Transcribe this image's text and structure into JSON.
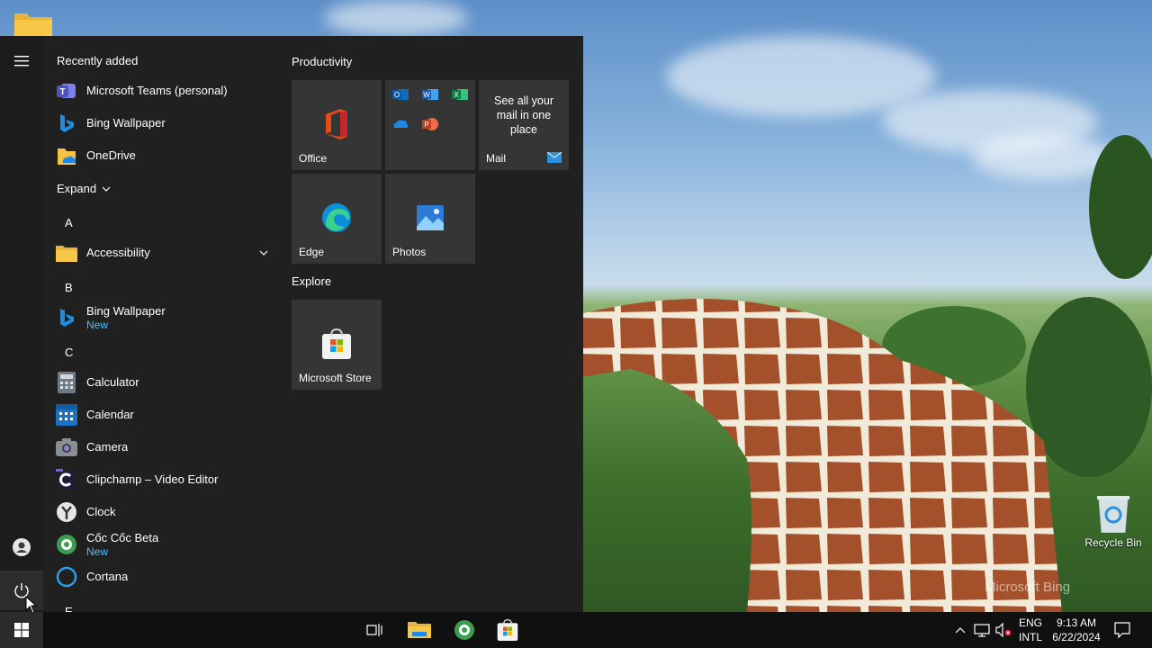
{
  "desktop": {
    "recycle_bin_label": "Recycle Bin",
    "watermark": "Microsoft Bing"
  },
  "start_menu": {
    "recently_added_label": "Recently added",
    "recent_apps": [
      {
        "name": "Microsoft Teams (personal)",
        "icon": "teams-icon"
      },
      {
        "name": "Bing Wallpaper",
        "icon": "bing-icon"
      },
      {
        "name": "OneDrive",
        "icon": "onedrive-icon"
      }
    ],
    "expand_label": "Expand",
    "letters": [
      "A",
      "B",
      "C",
      "E"
    ],
    "apps": [
      {
        "name": "Accessibility",
        "icon": "folder-icon"
      },
      {
        "name": "Bing Wallpaper",
        "sub": "New",
        "icon": "bing-icon"
      },
      {
        "name": "Calculator",
        "icon": "calculator-icon"
      },
      {
        "name": "Calendar",
        "icon": "calendar-icon"
      },
      {
        "name": "Camera",
        "icon": "camera-icon"
      },
      {
        "name": "Clipchamp – Video Editor",
        "icon": "clipchamp-icon"
      },
      {
        "name": "Clock",
        "icon": "clock-icon"
      },
      {
        "name": "Cốc Cốc Beta",
        "sub": "New",
        "icon": "coccoc-icon"
      },
      {
        "name": "Cortana",
        "icon": "cortana-icon"
      }
    ],
    "groups": {
      "productivity": "Productivity",
      "explore": "Explore"
    },
    "tiles": {
      "office": "Office",
      "mail_promo": "See all your mail in one place",
      "mail": "Mail",
      "edge": "Edge",
      "photos": "Photos",
      "store": "Microsoft Store"
    }
  },
  "taskbar": {
    "lang_top": "ENG",
    "lang_bottom": "INTL",
    "time": "9:13 AM",
    "date": "6/22/2024"
  },
  "colors": {
    "accent_blue": "#4cc2ff",
    "menu_bg": "#202020",
    "tile_bg": "#353535",
    "taskbar_bg": "#101010"
  }
}
